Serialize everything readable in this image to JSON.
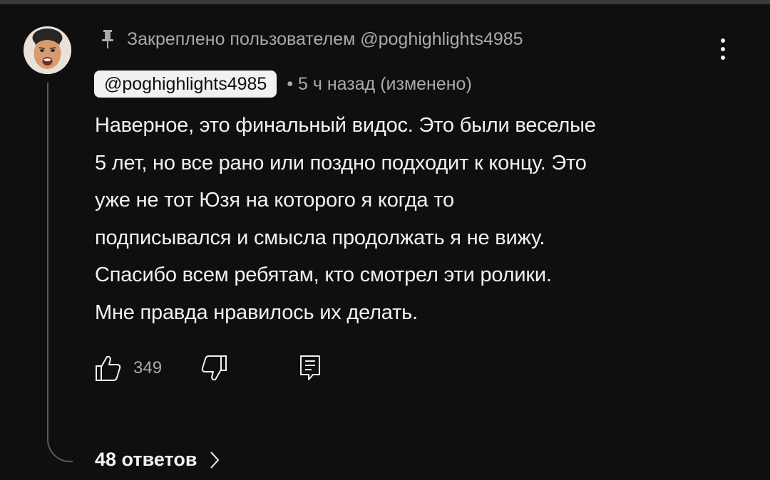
{
  "comment": {
    "pinned_label": "Закреплено пользователем @poghighlights4985",
    "author": "@poghighlights4985",
    "meta": "• 5 ч назад (изменено)",
    "text_lines": [
      "Наверное, это финальный видос. Это были веселые",
      "5 лет, но все рано или поздно подходит к концу. Это",
      "уже не тот Юзя на которого я когда то",
      "подписывался и смысла продолжать я не вижу.",
      "Спасибо всем ребятам, кто смотрел эти ролики.",
      "Мне правда нравилось их делать."
    ],
    "like_count": "349",
    "replies_label": "48 ответов"
  },
  "icons": {
    "pin": "pin-icon",
    "menu": "more-vert-icon",
    "like": "thumb-up-icon",
    "dislike": "thumb-down-icon",
    "reply": "reply-comment-icon",
    "replies_chevron": "chevron-right-icon"
  },
  "colors": {
    "background": "#0f0f0f",
    "primary_text": "#f1f1f1",
    "secondary_text": "#aaaaaa",
    "author_chip_bg": "#f1f1f1",
    "thread_line": "#5a5a5a"
  }
}
